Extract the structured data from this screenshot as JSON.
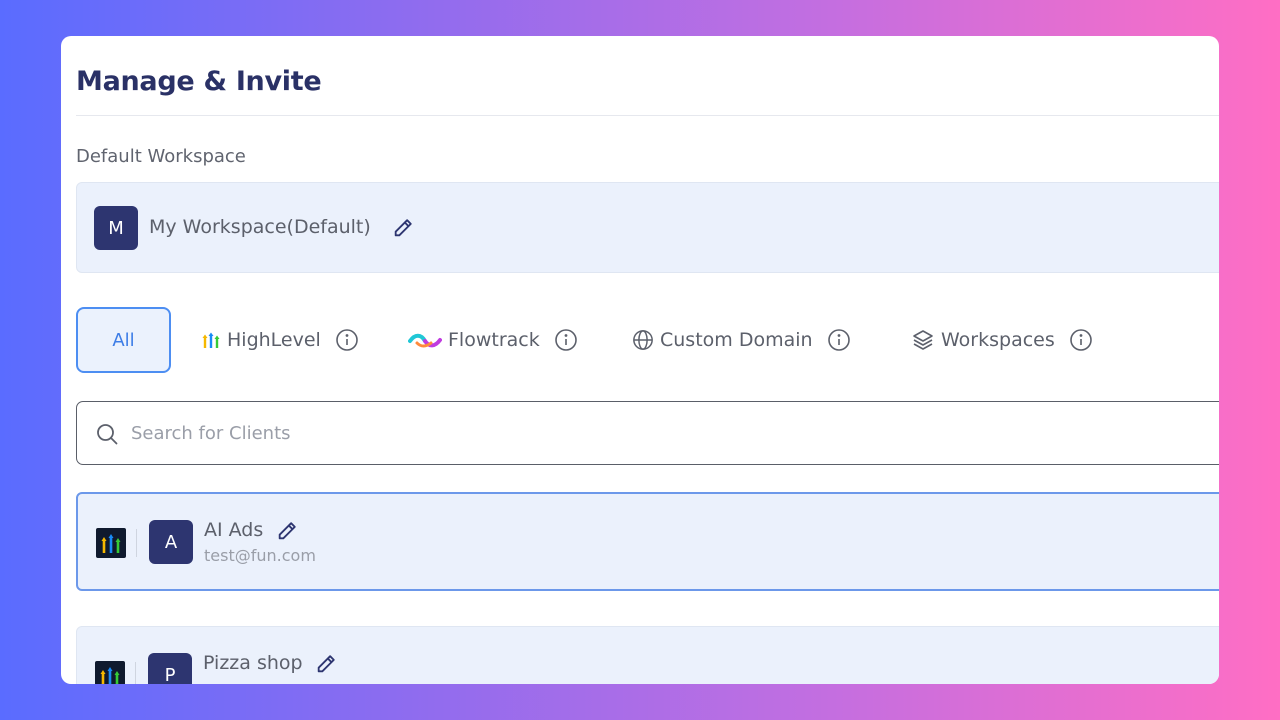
{
  "page": {
    "title": "Manage & Invite"
  },
  "default_workspace": {
    "section_label": "Default Workspace",
    "avatar_letter": "M",
    "name": "My Workspace(Default)"
  },
  "filters": {
    "all": "All",
    "highlevel": "HighLevel",
    "flowtrack": "Flowtrack",
    "custom_domain": "Custom Domain",
    "workspaces": "Workspaces"
  },
  "search": {
    "placeholder": "Search for Clients",
    "value": ""
  },
  "clients": [
    {
      "avatar_letter": "A",
      "name": "AI Ads",
      "email": "test@fun.com",
      "platform_icon": "highlevel-logo"
    },
    {
      "avatar_letter": "P",
      "name": "Pizza shop",
      "email": "",
      "platform_icon": "highlevel-logo"
    }
  ],
  "colors": {
    "title": "#2a3166",
    "avatar_bg": "#2d3570",
    "accent": "#4d8ef2",
    "row_bg": "#ebf1fc"
  }
}
